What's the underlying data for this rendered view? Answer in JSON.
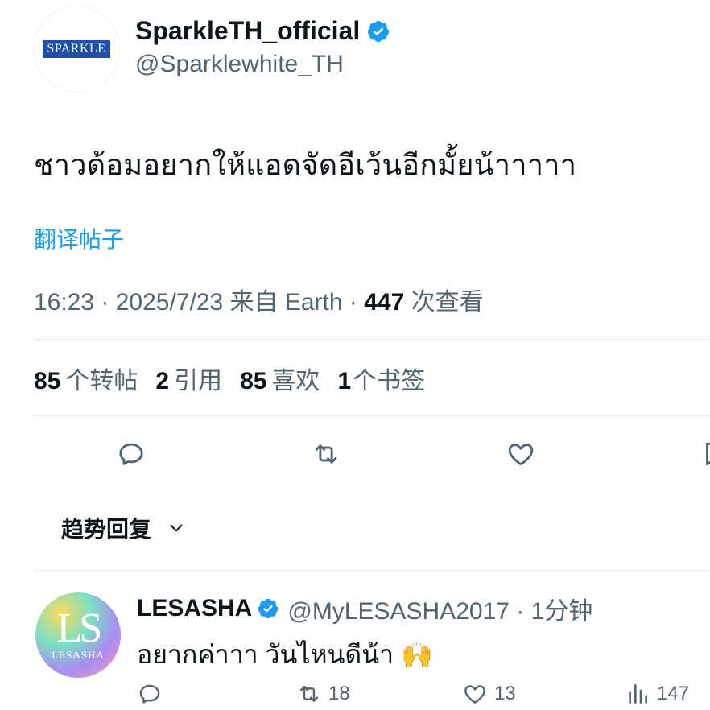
{
  "account": {
    "display_name": "SparkleTH_official",
    "handle": "@Sparklewhite_TH",
    "logo_text": "SPARKLE",
    "verified_color": "#1d9bf0"
  },
  "tweet": {
    "text": "ชาวด้อมอยากให้แอดจัดอีเว้นอีกมั้ยน้าาาาา",
    "translate_label": "翻译帖子",
    "meta_prefix": "16:23 · 2025/7/23 来自 Earth · ",
    "views_count": "447",
    "views_label": " 次查看"
  },
  "stats": {
    "reposts_count": "85",
    "reposts_label": "个转帖",
    "quotes_count": "2",
    "quotes_label": "引用",
    "likes_count": "85",
    "likes_label": "喜欢",
    "bookmarks_count": "1",
    "bookmarks_label": "个书签"
  },
  "actions": [
    "reply-icon",
    "repost-icon",
    "like-icon",
    "bookmark-icon"
  ],
  "replies_sort": {
    "label": "趋势回复"
  },
  "reply": {
    "avatar_text": "LS",
    "avatar_subtext": "LESASHA",
    "display_name": "LESASHA",
    "handle_time": "@MyLESASHA2017 · 1分钟",
    "text": "อยากค่าาา วันไหนดีน้า 🙌",
    "reposts": "18",
    "likes": "13",
    "views": "147"
  }
}
